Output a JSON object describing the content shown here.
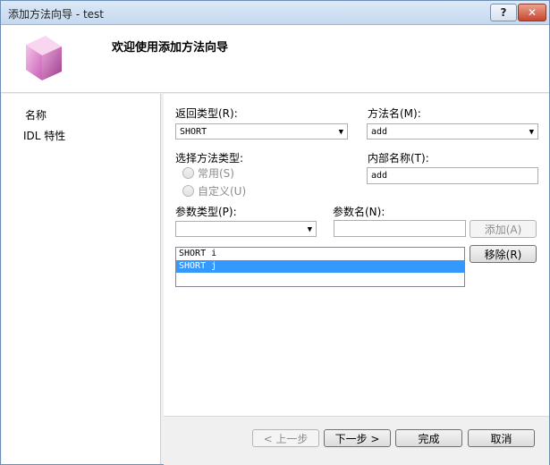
{
  "window": {
    "title": "添加方法向导 - test",
    "help_label": "?",
    "close_label": "✕"
  },
  "header": {
    "title": "欢迎使用添加方法向导"
  },
  "nav": {
    "items": [
      {
        "label": "名称"
      },
      {
        "label": "IDL 特性"
      }
    ]
  },
  "form": {
    "return_type": {
      "label": "返回类型(R):",
      "value": "SHORT"
    },
    "method_name": {
      "label": "方法名(M):",
      "value": "add"
    },
    "method_type": {
      "label": "选择方法类型:",
      "options": [
        "常用(S)",
        "自定义(U)"
      ]
    },
    "internal_name": {
      "label": "内部名称(T):",
      "value": "add"
    },
    "param_type": {
      "label": "参数类型(P):",
      "value": ""
    },
    "param_name": {
      "label": "参数名(N):",
      "value": ""
    },
    "add_label": "添加(A)",
    "remove_label": "移除(R)",
    "params": [
      "SHORT i",
      "SHORT j"
    ],
    "selected_param": 1
  },
  "footer": {
    "prev_label": "< 上一步",
    "next_label": "下一步 >",
    "finish_label": "完成",
    "cancel_label": "取消"
  },
  "colors": {
    "selection": "#3399ff",
    "titlebar": "#c4d8ef",
    "close": "#c7452d"
  }
}
